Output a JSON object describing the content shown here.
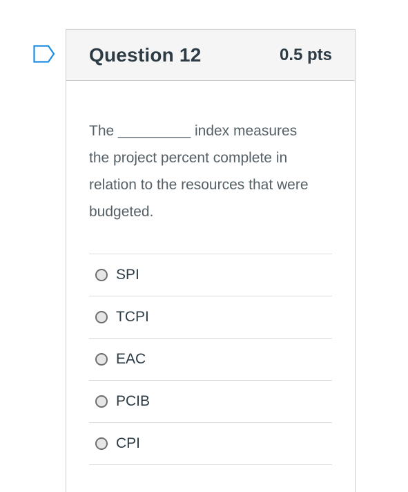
{
  "question": {
    "title": "Question 12",
    "points": "0.5 pts",
    "text_lines": [
      "The _________ index measures",
      "the project percent complete in",
      "relation to the resources that were",
      "budgeted."
    ]
  },
  "answers": [
    {
      "label": "SPI"
    },
    {
      "label": "TCPI"
    },
    {
      "label": "EAC"
    },
    {
      "label": "PCIB"
    },
    {
      "label": "CPI"
    }
  ],
  "icons": {
    "flag": "flag-outline-icon",
    "radio": "radio-unchecked-icon"
  },
  "colors": {
    "flag_stroke": "#1f8ee0",
    "header_bg": "#f5f5f5",
    "title": "#2d3b45",
    "body_text": "#555f66"
  }
}
